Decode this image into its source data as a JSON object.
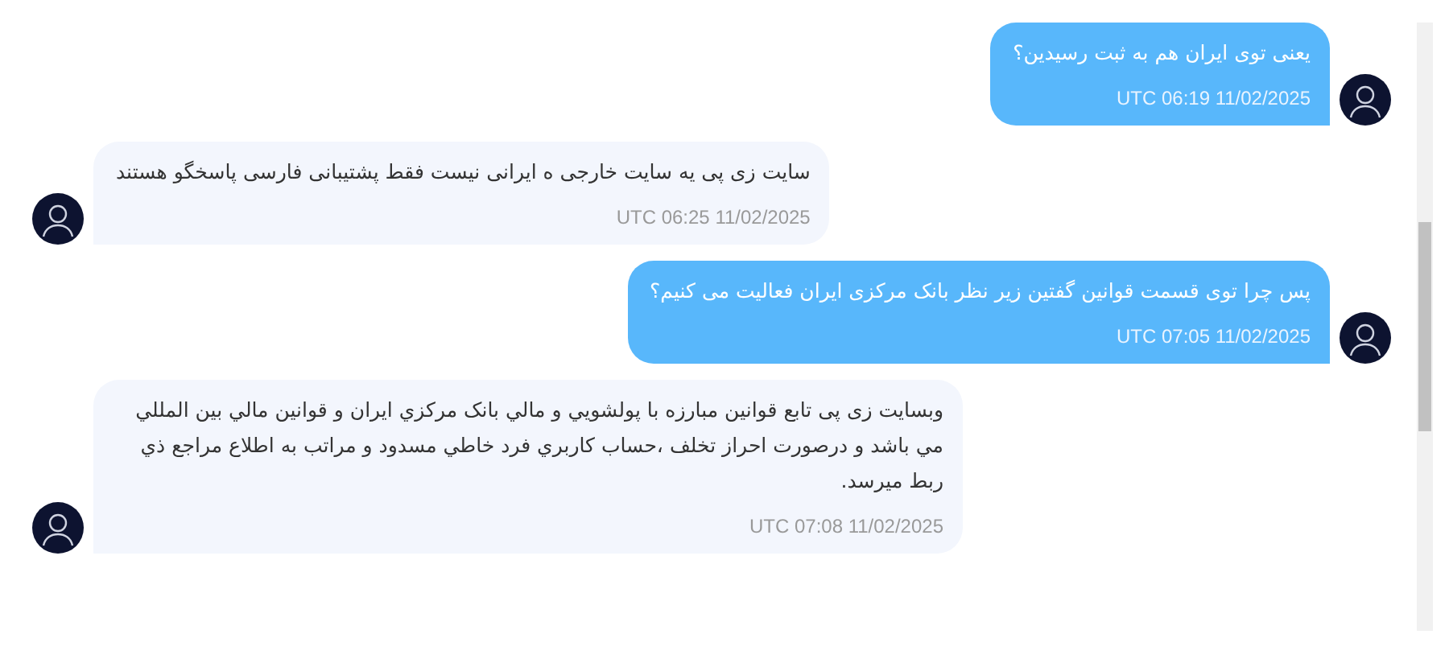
{
  "messages": [
    {
      "kind": "outgoing",
      "text": "یعنی توی ایران هم به ثبت رسیدین؟",
      "time": "UTC 06:19 11/02/2025"
    },
    {
      "kind": "incoming",
      "text": "سایت زی پی یه سایت خارجی ه ایرانی نیست فقط پشتیبانی فارسی پاسخگو هستند",
      "time": "UTC 06:25 11/02/2025"
    },
    {
      "kind": "outgoing",
      "text": "پس چرا توی قسمت قوانین گفتین زیر نظر بانک مرکزی ایران فعالیت می کنیم؟",
      "time": "UTC 07:05 11/02/2025"
    },
    {
      "kind": "incoming",
      "text": "وبسایت زی پی تابع قوانین مبارزه با پولشويي و مالي بانک مرکزي ايران و قوانين مالي بين المللي مي باشد و درصورت احراز تخلف ،حساب کاربري فرد خاطي مسدود و مراتب به اطلاع مراجع ذي ربط ميرسد.",
      "time": "UTC 07:08 11/02/2025"
    }
  ]
}
